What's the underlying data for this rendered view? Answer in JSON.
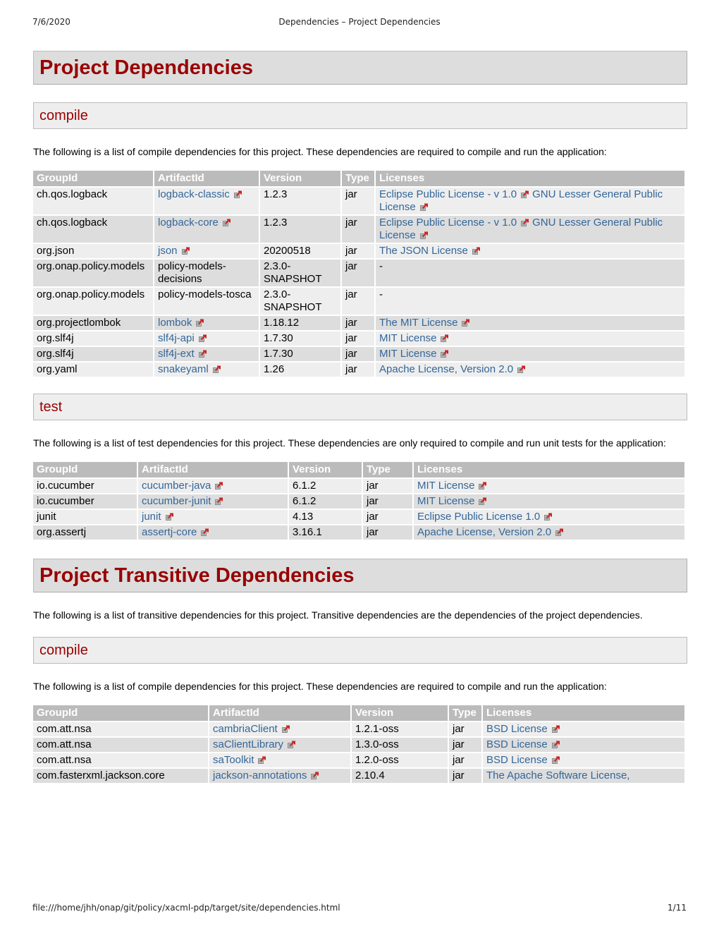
{
  "print_header": {
    "date": "7/6/2020",
    "title": "Dependencies – Project Dependencies"
  },
  "print_footer": {
    "url": "file:///home/jhh/onap/git/policy/xacml-pdp/target/site/dependencies.html",
    "page": "1/11"
  },
  "colors": {
    "heading": "#990000",
    "link": "#336699",
    "table_header": "#bbbbbb",
    "row_odd": "#eeeeee",
    "row_even": "#dddddd"
  },
  "icons": {
    "external_link": "external-link-icon"
  },
  "columns": [
    "GroupId",
    "ArtifactId",
    "Version",
    "Type",
    "Licenses"
  ],
  "project_dependencies": {
    "title": "Project Dependencies",
    "compile": {
      "title": "compile",
      "description": "The following is a list of compile dependencies for this project. These dependencies are required to compile and run the application:",
      "rows": [
        {
          "group": "ch.qos.logback",
          "artifact": "logback-classic",
          "artifact_link": true,
          "version": "1.2.3",
          "type": "jar",
          "licenses": [
            "Eclipse Public License - v 1.0",
            "GNU Lesser General Public License"
          ]
        },
        {
          "group": "ch.qos.logback",
          "artifact": "logback-core",
          "artifact_link": true,
          "version": "1.2.3",
          "type": "jar",
          "licenses": [
            "Eclipse Public License - v 1.0",
            "GNU Lesser General Public License"
          ]
        },
        {
          "group": "org.json",
          "artifact": "json",
          "artifact_link": true,
          "version": "20200518",
          "type": "jar",
          "licenses": [
            "The JSON License"
          ]
        },
        {
          "group": "org.onap.policy.models",
          "artifact": "policy-models-decisions",
          "artifact_link": false,
          "version": "2.3.0-SNAPSHOT",
          "type": "jar",
          "licenses": [],
          "licenses_text": "-"
        },
        {
          "group": "org.onap.policy.models",
          "artifact": "policy-models-tosca",
          "artifact_link": false,
          "version": "2.3.0-SNAPSHOT",
          "type": "jar",
          "licenses": [],
          "licenses_text": "-"
        },
        {
          "group": "org.projectlombok",
          "artifact": "lombok",
          "artifact_link": true,
          "version": "1.18.12",
          "type": "jar",
          "licenses": [
            "The MIT License"
          ]
        },
        {
          "group": "org.slf4j",
          "artifact": "slf4j-api",
          "artifact_link": true,
          "version": "1.7.30",
          "type": "jar",
          "licenses": [
            "MIT License"
          ]
        },
        {
          "group": "org.slf4j",
          "artifact": "slf4j-ext",
          "artifact_link": true,
          "version": "1.7.30",
          "type": "jar",
          "licenses": [
            "MIT License"
          ]
        },
        {
          "group": "org.yaml",
          "artifact": "snakeyaml",
          "artifact_link": true,
          "version": "1.26",
          "type": "jar",
          "licenses": [
            "Apache License, Version 2.0"
          ]
        }
      ]
    },
    "test": {
      "title": "test",
      "description": "The following is a list of test dependencies for this project. These dependencies are only required to compile and run unit tests for the application:",
      "rows": [
        {
          "group": "io.cucumber",
          "artifact": "cucumber-java",
          "artifact_link": true,
          "version": "6.1.2",
          "type": "jar",
          "licenses": [
            "MIT License"
          ]
        },
        {
          "group": "io.cucumber",
          "artifact": "cucumber-junit",
          "artifact_link": true,
          "version": "6.1.2",
          "type": "jar",
          "licenses": [
            "MIT License"
          ]
        },
        {
          "group": "junit",
          "artifact": "junit",
          "artifact_link": true,
          "version": "4.13",
          "type": "jar",
          "licenses": [
            "Eclipse Public License 1.0"
          ]
        },
        {
          "group": "org.assertj",
          "artifact": "assertj-core",
          "artifact_link": true,
          "version": "3.16.1",
          "type": "jar",
          "licenses": [
            "Apache License, Version 2.0"
          ]
        }
      ]
    }
  },
  "transitive_dependencies": {
    "title": "Project Transitive Dependencies",
    "description": "The following is a list of transitive dependencies for this project. Transitive dependencies are the dependencies of the project dependencies.",
    "compile": {
      "title": "compile",
      "description": "The following is a list of compile dependencies for this project. These dependencies are required to compile and run the application:",
      "rows": [
        {
          "group": "com.att.nsa",
          "artifact": "cambriaClient",
          "artifact_link": true,
          "version": "1.2.1-oss",
          "type": "jar",
          "licenses": [
            "BSD License"
          ]
        },
        {
          "group": "com.att.nsa",
          "artifact": "saClientLibrary",
          "artifact_link": true,
          "version": "1.3.0-oss",
          "type": "jar",
          "licenses": [
            "BSD License"
          ]
        },
        {
          "group": "com.att.nsa",
          "artifact": "saToolkit",
          "artifact_link": true,
          "version": "1.2.0-oss",
          "type": "jar",
          "licenses": [
            "BSD License"
          ]
        },
        {
          "group": "com.fasterxml.jackson.core",
          "artifact": "jackson-annotations",
          "artifact_link": true,
          "version": "2.10.4",
          "type": "jar",
          "licenses": [
            "The Apache Software License,"
          ],
          "licenses_truncated": true
        }
      ]
    }
  }
}
